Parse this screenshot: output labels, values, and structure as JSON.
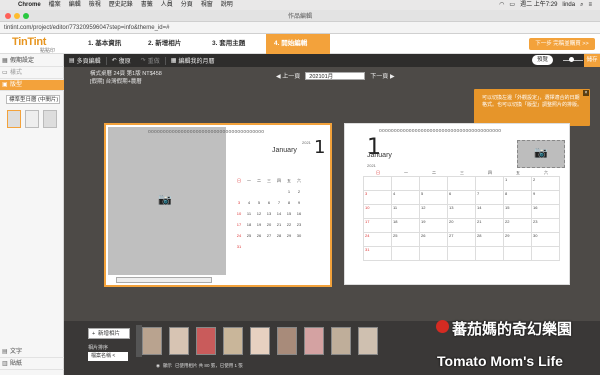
{
  "menubar": {
    "app": "Chrome",
    "items": [
      "檔案",
      "編輯",
      "檢視",
      "歷史記錄",
      "書籤",
      "人員",
      "分頁",
      "視窗",
      "說明"
    ],
    "time": "週二 上午7:29",
    "user": "linda"
  },
  "window": {
    "title": "作品編輯"
  },
  "address": {
    "url": "tintint.com/project/editor/773209596047step=info&theme_id=#"
  },
  "header": {
    "logo": "TinTint",
    "logo_sub": "點點印",
    "steps": [
      "1. 基本資訊",
      "2. 新增相片",
      "3. 套用主題",
      "4. 開始編輯"
    ],
    "next_button": "下一步 完稿並購買 >>"
  },
  "sidebar": {
    "items": [
      "假期設定",
      "樣式",
      "版型"
    ],
    "select_value": "標準型日曆 (中間片)",
    "bottom_items": [
      "文字",
      "貼紙"
    ]
  },
  "toolbar": {
    "items": [
      "多頁編輯",
      "復原",
      "重做",
      "編輯我的月曆"
    ],
    "preview": "預覽",
    "save": "儲存"
  },
  "order": {
    "line1": "橫式桌曆 24頁 第1版 NT$458",
    "line2": "[假期] 台灣假期+農曆"
  },
  "nav": {
    "prev": "上一頁",
    "month": "202101月",
    "next": "下一頁"
  },
  "tooltip": {
    "text": "可以切換左邊「外觀設定」，選擇適合的日期格式。也可以切換「版型」調整照片的排版。"
  },
  "calendar": {
    "big_number": "1",
    "month_name": "January",
    "year": "2021",
    "weekday_headers": [
      "日",
      "一",
      "二",
      "三",
      "四",
      "五",
      "六"
    ],
    "weeks": [
      [
        "",
        "",
        "",
        "",
        "",
        "1",
        "2"
      ],
      [
        "3",
        "4",
        "5",
        "6",
        "7",
        "8",
        "9"
      ],
      [
        "10",
        "11",
        "12",
        "13",
        "14",
        "15",
        "16"
      ],
      [
        "17",
        "18",
        "19",
        "20",
        "21",
        "22",
        "23"
      ],
      [
        "24",
        "25",
        "26",
        "27",
        "28",
        "29",
        "30"
      ],
      [
        "31",
        "",
        "",
        "",
        "",
        "",
        ""
      ]
    ]
  },
  "bottom": {
    "add_photo": "新增相片",
    "sort_label": "相片排序",
    "sort_value": "檔案名稱 <",
    "status_show": "顯示",
    "status_text": "已使用相片  共 80 張，已使用 1 張"
  },
  "watermark": {
    "line1": "蕃茄媽的奇幻樂園",
    "line2": "Tomato Mom's Life"
  },
  "colors": {
    "accent": "#f3a23b",
    "tooltip": "#e6952a"
  }
}
